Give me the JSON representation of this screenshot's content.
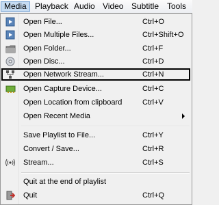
{
  "menubar": {
    "items": [
      "Media",
      "Playback",
      "Audio",
      "Video",
      "Subtitle",
      "Tools"
    ]
  },
  "menu": {
    "items": [
      {
        "label": "Open File...",
        "shortcut": "Ctrl+O",
        "icon": "media-file-icon"
      },
      {
        "label": "Open Multiple Files...",
        "shortcut": "Ctrl+Shift+O",
        "icon": "media-file-icon"
      },
      {
        "label": "Open Folder...",
        "shortcut": "Ctrl+F",
        "icon": "folder-icon"
      },
      {
        "label": "Open Disc...",
        "shortcut": "Ctrl+D",
        "icon": "disc-icon"
      },
      {
        "label": "Open Network Stream...",
        "shortcut": "Ctrl+N",
        "icon": "network-icon"
      },
      {
        "label": "Open Capture Device...",
        "shortcut": "Ctrl+C",
        "icon": "capture-card-icon"
      },
      {
        "label": "Open Location from clipboard",
        "shortcut": "Ctrl+V",
        "icon": ""
      },
      {
        "label": "Open Recent Media",
        "shortcut": "",
        "icon": ""
      },
      {
        "label": "Save Playlist to File...",
        "shortcut": "Ctrl+Y",
        "icon": ""
      },
      {
        "label": "Convert / Save...",
        "shortcut": "Ctrl+R",
        "icon": ""
      },
      {
        "label": "Stream...",
        "shortcut": "Ctrl+S",
        "icon": "stream-icon"
      },
      {
        "label": "Quit at the end of playlist",
        "shortcut": "",
        "icon": ""
      },
      {
        "label": "Quit",
        "shortcut": "Ctrl+Q",
        "icon": "exit-icon"
      }
    ]
  },
  "colors": {
    "menu_bg": "#f0f0f0",
    "menubar_active": "#c6dcf2",
    "highlight_border": "#000000"
  }
}
